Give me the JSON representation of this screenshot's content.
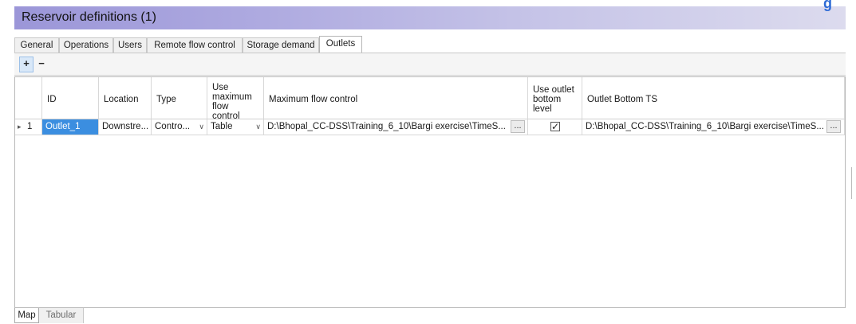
{
  "window": {
    "title": "Reservoir definitions (1)",
    "corner_glyph": "g"
  },
  "tabs": [
    {
      "label": "General",
      "active": false
    },
    {
      "label": "Operations",
      "active": false
    },
    {
      "label": "Users",
      "active": false
    },
    {
      "label": "Remote flow control",
      "active": false
    },
    {
      "label": "Storage demand",
      "active": false
    },
    {
      "label": "Outlets",
      "active": true
    }
  ],
  "toolbar": {
    "add_label": "+",
    "remove_label": "−"
  },
  "grid": {
    "columns": [
      {
        "key": "id",
        "label": "ID"
      },
      {
        "key": "location",
        "label": "Location"
      },
      {
        "key": "type",
        "label": "Type"
      },
      {
        "key": "use_max_flow",
        "label": "Use maximum flow control"
      },
      {
        "key": "max_flow_control",
        "label": "Maximum flow control"
      },
      {
        "key": "use_outlet_bottom",
        "label": "Use outlet bottom level"
      },
      {
        "key": "outlet_bottom_ts",
        "label": "Outlet Bottom TS"
      }
    ],
    "header_visible_lines": {
      "use_max_flow": [
        "Use",
        "maximum",
        "flow",
        "control"
      ],
      "use_outlet_bottom": [
        "Use outlet",
        "bottom",
        "level"
      ]
    },
    "rows": [
      {
        "row_number": "1",
        "row_marker": "▸",
        "id": "Outlet_1",
        "location": "Downstre...",
        "type": "Contro...",
        "use_max_flow": "Table",
        "max_flow_control": "D:\\Bhopal_CC-DSS\\Training_6_10\\Bargi exercise\\TimeS...",
        "use_outlet_bottom": true,
        "outlet_bottom_ts": "D:\\Bhopal_CC-DSS\\Training_6_10\\Bargi exercise\\TimeS...",
        "ellipsis": "..."
      }
    ]
  },
  "bottom_tabs": [
    {
      "label": "Map",
      "active": true
    },
    {
      "label": "Tabular",
      "active": false
    }
  ],
  "colors": {
    "title_gradient_start": "#9b96d8",
    "title_gradient_end": "#dcdbee",
    "selection": "#3b8ee0",
    "corner_glyph": "#2e6bd6"
  }
}
